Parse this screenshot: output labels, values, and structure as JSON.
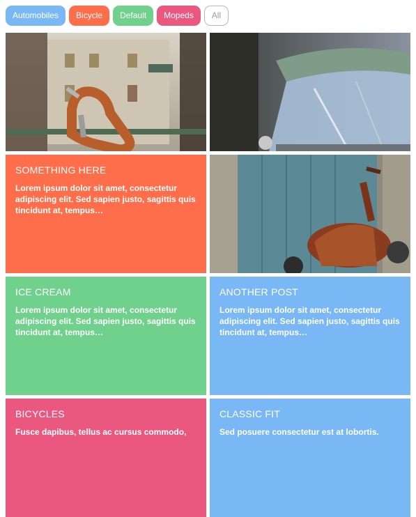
{
  "filters": [
    {
      "label": "Automobiles",
      "color": "#7ab8f5"
    },
    {
      "label": "Bicycle",
      "color": "#ff6e4a"
    },
    {
      "label": "Default",
      "color": "#6fd18b"
    },
    {
      "label": "Mopeds",
      "color": "#ea5880"
    },
    {
      "label": "All",
      "color": "#ffffff"
    }
  ],
  "tiles": {
    "photo_bicycle": {
      "icon": "bicycle-handlebar-photo"
    },
    "photo_car": {
      "icon": "car-windshield-photo"
    },
    "something_here": {
      "title": "SOMETHING HERE",
      "body": "Lorem ipsum dolor sit amet, consectetur adipiscing elit. Sed sapien justo, sagittis quis tincidunt at, tempus…",
      "color": "#ff6e4a"
    },
    "photo_moped": {
      "icon": "moped-photo"
    },
    "ice_cream": {
      "title": "ICE CREAM",
      "body": "Lorem ipsum dolor sit amet, consectetur adipiscing elit. Sed sapien justo, sagittis quis tincidunt at, tempus…",
      "color": "#6fd18b"
    },
    "another_post": {
      "title": "ANOTHER POST",
      "body": "Lorem ipsum dolor sit amet, consectetur adipiscing elit. Sed sapien justo, sagittis quis tincidunt at, tempus…",
      "color": "#7ab8f5"
    },
    "bicycles": {
      "title": "BICYCLES",
      "body": "Fusce dapibus, tellus ac cursus commodo,",
      "color": "#ea5880"
    },
    "classic_fit": {
      "title": "CLASSIC FIT",
      "body": "Sed posuere consectetur est at lobortis.",
      "color": "#7ab8f5"
    }
  }
}
